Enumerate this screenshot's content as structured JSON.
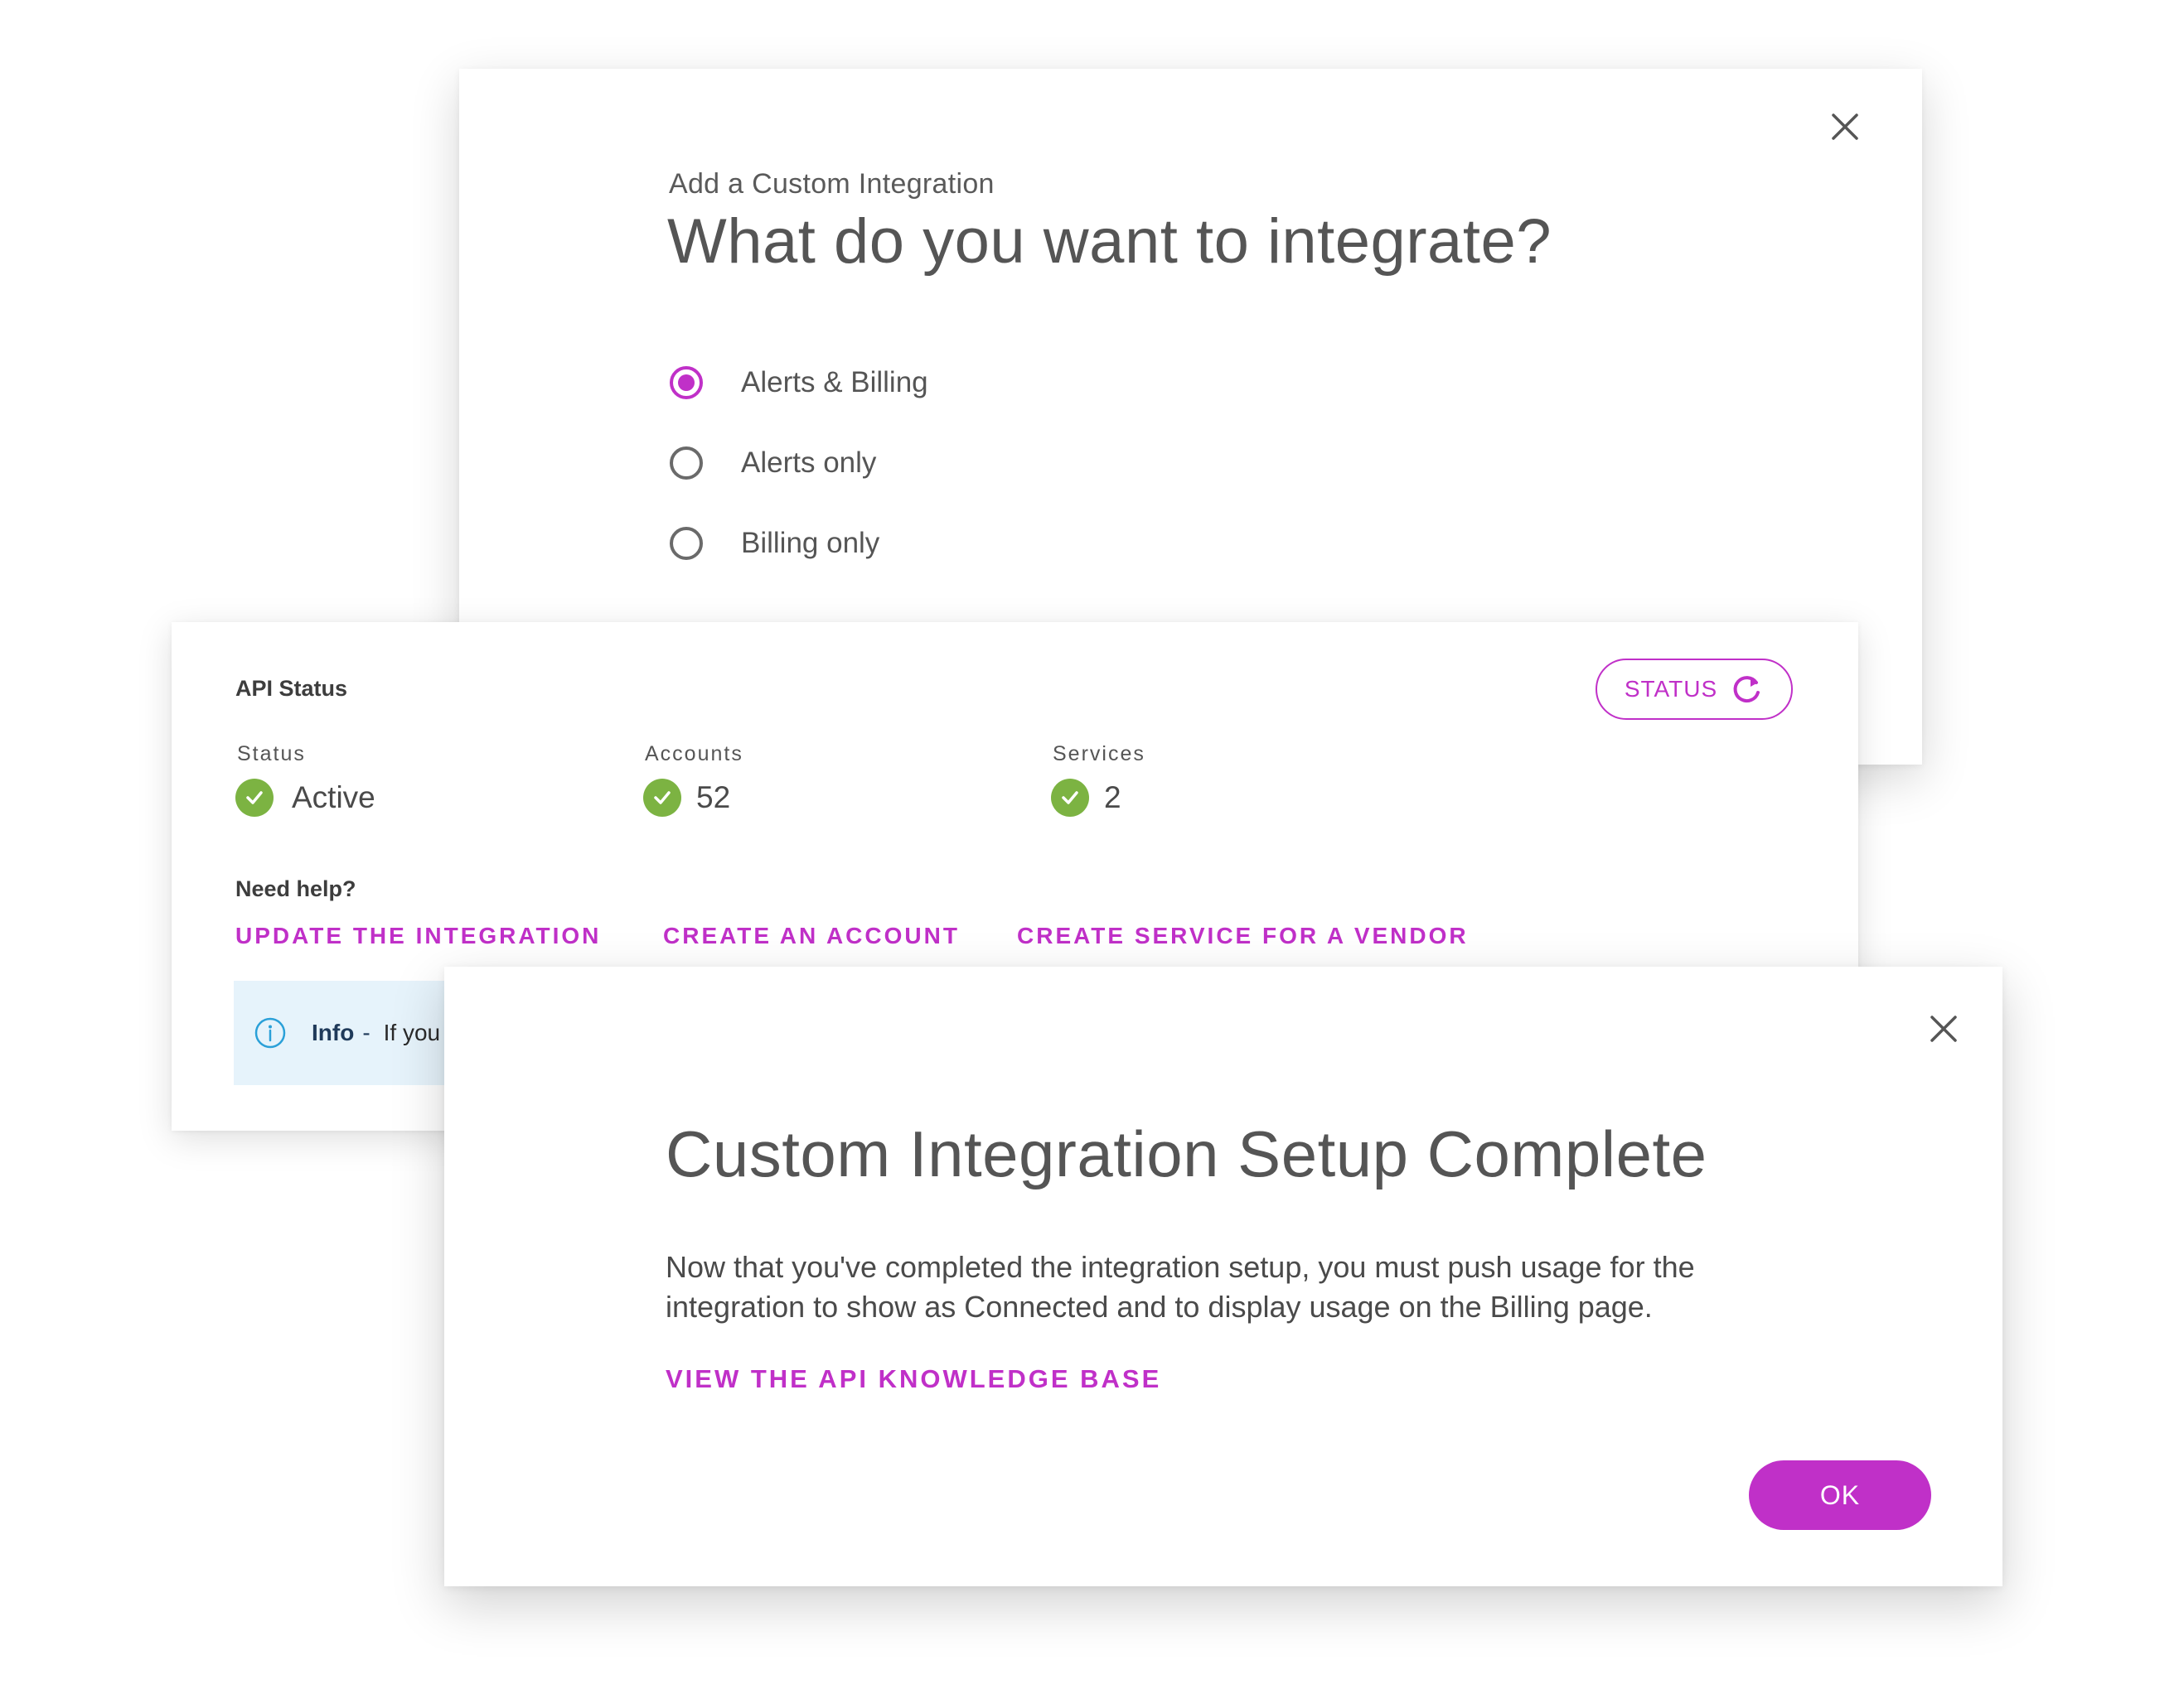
{
  "integrate_dialog": {
    "subtitle": "Add a Custom Integration",
    "title": "What do you want to integrate?",
    "options": [
      {
        "label": "Alerts & Billing",
        "selected": true
      },
      {
        "label": "Alerts only",
        "selected": false
      },
      {
        "label": "Billing only",
        "selected": false
      }
    ],
    "close_icon": "close-icon"
  },
  "api_status": {
    "title": "API Status",
    "status_button": "STATUS",
    "status_button_icon": "refresh-icon",
    "stats": [
      {
        "label": "Status",
        "value": "Active",
        "icon": "check-circle-icon"
      },
      {
        "label": "Accounts",
        "value": "52",
        "icon": "check-circle-icon"
      },
      {
        "label": "Services",
        "value": "2",
        "icon": "check-circle-icon"
      }
    ],
    "help_title": "Need help?",
    "links": [
      "UPDATE THE INTEGRATION",
      "CREATE AN ACCOUNT",
      "CREATE SERVICE FOR A VENDOR"
    ],
    "info": {
      "icon": "info-icon",
      "title": "Info",
      "dash": "-",
      "text": "If you"
    }
  },
  "complete_dialog": {
    "title": "Custom Integration Setup Complete",
    "body": "Now that you've completed the integration setup, you must push usage for the integration to show as Connected and to display usage on the Billing page.",
    "link": "VIEW THE API KNOWLEDGE BASE",
    "ok_button": "OK",
    "close_icon": "close-icon"
  },
  "colors": {
    "accent": "#c030c8",
    "success": "#7cb342",
    "info_bg": "#e6f3fb",
    "text": "#4a4a4a"
  }
}
